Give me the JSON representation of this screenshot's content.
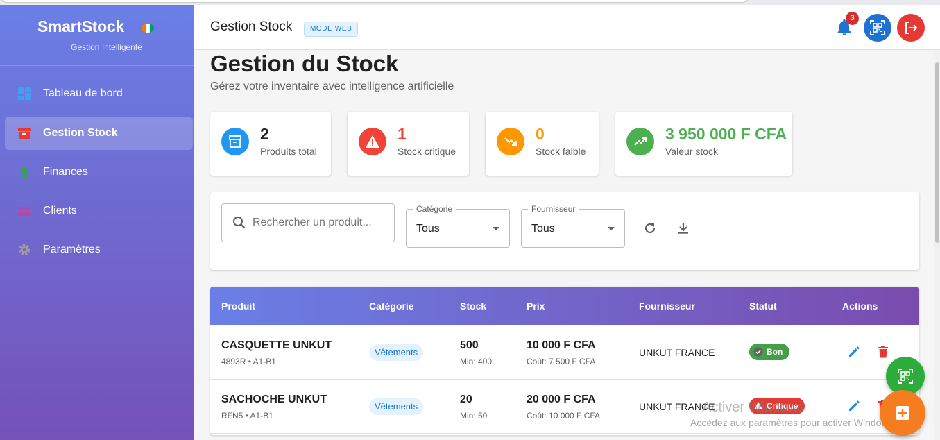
{
  "app": {
    "brand": "SmartStock",
    "tagline": "Gestion Intelligente",
    "flag_colors": [
      "#f77f00",
      "#ffffff",
      "#009e60"
    ]
  },
  "sidebar": {
    "items": [
      {
        "label": "Tableau de bord",
        "icon": "dashboard-icon",
        "active": false
      },
      {
        "label": "Gestion Stock",
        "icon": "inventory-box-icon",
        "active": true
      },
      {
        "label": "Finances",
        "icon": "dollar-icon",
        "active": false
      },
      {
        "label": "Clients",
        "icon": "people-icon",
        "active": false
      },
      {
        "label": "Paramètres",
        "icon": "gear-icon",
        "active": false
      }
    ]
  },
  "header": {
    "title": "Gestion Stock",
    "mode_chip": "MODE WEB",
    "notification_count": "3",
    "icons": [
      "bell-icon",
      "qr-scan-icon",
      "logout-icon"
    ]
  },
  "page": {
    "title": "Gestion du Stock",
    "subtitle": "Gérez votre inventaire avec intelligence artificielle"
  },
  "stats": [
    {
      "value": "2",
      "label": "Produits total",
      "color": "#2196f3",
      "value_color": "#212121",
      "icon": "archive-icon"
    },
    {
      "value": "1",
      "label": "Stock critique",
      "color": "#f44336",
      "value_color": "#f44336",
      "icon": "warning-icon"
    },
    {
      "value": "0",
      "label": "Stock faible",
      "color": "#ff9800",
      "value_color": "#ff9800",
      "icon": "trending-down-icon"
    },
    {
      "value": "3 950 000 F CFA",
      "label": "Valeur stock",
      "color": "#4caf50",
      "value_color": "#4caf50",
      "icon": "trending-up-icon"
    }
  ],
  "filters": {
    "search_placeholder": "Rechercher un produit...",
    "category_label": "Catégorie",
    "category_value": "Tous",
    "supplier_label": "Fournisseur",
    "supplier_value": "Tous"
  },
  "table": {
    "headers": [
      "Produit",
      "Catégorie",
      "Stock",
      "Prix",
      "Fournisseur",
      "Statut",
      "Actions"
    ],
    "rows": [
      {
        "name": "CASQUETTE UNKUT",
        "ref": "4893R • A1-B1",
        "category": "Vêtements",
        "stock": "500",
        "min": "Min: 400",
        "price": "10 000 F CFA",
        "cost": "Coût: 7 500 F CFA",
        "supplier": "UNKUT FRANCE",
        "status": "Bon",
        "status_color": "#43a047"
      },
      {
        "name": "SACHOCHE UNKUT",
        "ref": "RFN5 • A1-B1",
        "category": "Vêtements",
        "stock": "20",
        "min": "Min: 50",
        "price": "20 000 F CFA",
        "cost": "Coût: 10 000 F CFA",
        "supplier": "UNKUT FRANCE",
        "status": "Critique",
        "status_color": "#e53935"
      }
    ]
  },
  "watermark": {
    "title": "Activer Windows",
    "subtitle": "Accédez aux paramètres pour activer Windows."
  }
}
